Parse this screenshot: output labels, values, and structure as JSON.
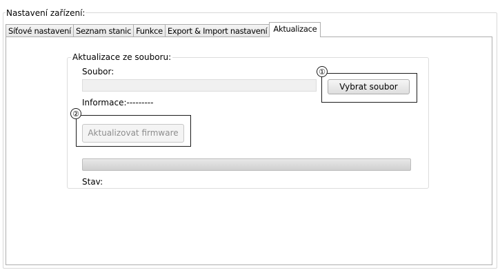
{
  "settings": {
    "title": "Nastavení zařízení:"
  },
  "tabs": [
    {
      "label": "Síťové nastavení",
      "active": false
    },
    {
      "label": "Seznam stanic",
      "active": false
    },
    {
      "label": "Funkce",
      "active": false
    },
    {
      "label": "Export & Import nastavení",
      "active": false
    },
    {
      "label": "Aktualizace",
      "active": true
    }
  ],
  "update": {
    "group_title": "Aktualizace ze souboru:",
    "file_label": "Soubor:",
    "file_value": "",
    "select_button": "Vybrat soubor",
    "info_label": "Informace:---------",
    "update_button": "Aktualizovat firmware",
    "update_enabled": false,
    "progress_fraction": 0,
    "status_label": "Stav:"
  },
  "callouts": [
    "①",
    "②"
  ],
  "colors": {
    "progress_fill": "#06b025",
    "disabled_text": "#8d8d8d",
    "callout": "#1a1a1a"
  }
}
